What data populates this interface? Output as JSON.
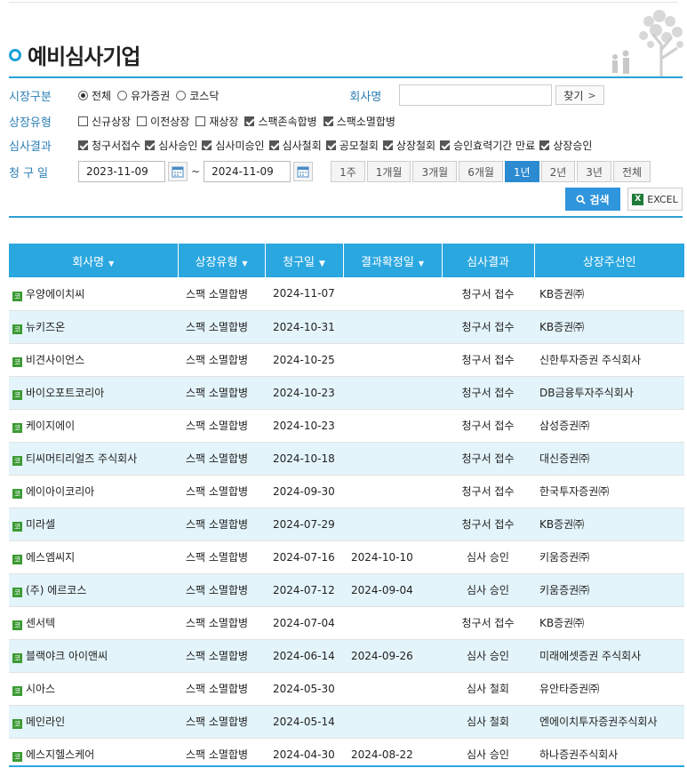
{
  "title": "예비심사기업",
  "filters": {
    "market": {
      "label": "시장구분",
      "options": [
        {
          "text": "전체",
          "selected": true
        },
        {
          "text": "유가증권",
          "selected": false
        },
        {
          "text": "코스닥",
          "selected": false
        }
      ],
      "company_label": "회사명",
      "company_value": "",
      "find_label": "찾기"
    },
    "listing_type": {
      "label": "상장유형",
      "options": [
        {
          "text": "신규상장",
          "checked": false
        },
        {
          "text": "이전상장",
          "checked": false
        },
        {
          "text": "재상장",
          "checked": false
        },
        {
          "text": "스팩존속합병",
          "checked": true
        },
        {
          "text": "스팩소멸합병",
          "checked": true
        }
      ]
    },
    "review_result": {
      "label": "심사결과",
      "options": [
        {
          "text": "청구서접수",
          "checked": true
        },
        {
          "text": "심사승인",
          "checked": true
        },
        {
          "text": "심사미승인",
          "checked": true
        },
        {
          "text": "심사철회",
          "checked": true
        },
        {
          "text": "공모철회",
          "checked": true
        },
        {
          "text": "상장철회",
          "checked": true
        },
        {
          "text": "승인효력기간 만료",
          "checked": true
        },
        {
          "text": "상장승인",
          "checked": true
        }
      ]
    },
    "claim_date": {
      "label": "청 구 일",
      "from": "2023-11-09",
      "to": "2024-11-09",
      "tilde": "~",
      "periods": [
        {
          "text": "1주",
          "active": false
        },
        {
          "text": "1개월",
          "active": false
        },
        {
          "text": "3개월",
          "active": false
        },
        {
          "text": "6개월",
          "active": false
        },
        {
          "text": "1년",
          "active": true
        },
        {
          "text": "2년",
          "active": false
        },
        {
          "text": "3년",
          "active": false
        },
        {
          "text": "전체",
          "active": false
        }
      ]
    }
  },
  "buttons": {
    "search": "검색",
    "excel": "EXCEL"
  },
  "table": {
    "headers": [
      {
        "text": "회사명",
        "sort": true
      },
      {
        "text": "상장유형",
        "sort": true
      },
      {
        "text": "청구일",
        "sort": true,
        "bold_arrow": true
      },
      {
        "text": "결과확정일",
        "sort": true
      },
      {
        "text": "심사결과",
        "sort": false
      },
      {
        "text": "상장주선인",
        "sort": false
      }
    ],
    "market_mark": "코",
    "rows": [
      [
        "우양에이치씨",
        "스팩 소멸합병",
        "2024-11-07",
        "",
        "청구서 접수",
        "KB증권㈜"
      ],
      [
        "뉴키즈온",
        "스팩 소멸합병",
        "2024-10-31",
        "",
        "청구서 접수",
        "KB증권㈜"
      ],
      [
        "비견사이언스",
        "스팩 소멸합병",
        "2024-10-25",
        "",
        "청구서 접수",
        "신한투자증권 주식회사"
      ],
      [
        "바이오포트코리아",
        "스팩 소멸합병",
        "2024-10-23",
        "",
        "청구서 접수",
        "DB금융투자주식회사"
      ],
      [
        "케이지에이",
        "스팩 소멸합병",
        "2024-10-23",
        "",
        "청구서 접수",
        "삼성증권㈜"
      ],
      [
        "티씨머티리얼즈 주식회사",
        "스팩 소멸합병",
        "2024-10-18",
        "",
        "청구서 접수",
        "대신증권㈜"
      ],
      [
        "에이아이코리아",
        "스팩 소멸합병",
        "2024-09-30",
        "",
        "청구서 접수",
        "한국투자증권㈜"
      ],
      [
        "미라셀",
        "스팩 소멸합병",
        "2024-07-29",
        "",
        "청구서 접수",
        "KB증권㈜"
      ],
      [
        "에스엠씨지",
        "스팩 소멸합병",
        "2024-07-16",
        "2024-10-10",
        "심사 승인",
        "키움증권㈜"
      ],
      [
        "(주) 에르코스",
        "스팩 소멸합병",
        "2024-07-12",
        "2024-09-04",
        "심사 승인",
        "키움증권㈜"
      ],
      [
        "센서텍",
        "스팩 소멸합병",
        "2024-07-04",
        "",
        "청구서 접수",
        "KB증권㈜"
      ],
      [
        "블랙야크 아이앤씨",
        "스팩 소멸합병",
        "2024-06-14",
        "2024-09-26",
        "심사 승인",
        "미래에셋증권 주식회사"
      ],
      [
        "시아스",
        "스팩 소멸합병",
        "2024-05-30",
        "",
        "심사 철회",
        "유안타증권㈜"
      ],
      [
        "메인라인",
        "스팩 소멸합병",
        "2024-05-14",
        "",
        "심사 철회",
        "엔에이치투자증권주식회사"
      ],
      [
        "에스지헬스케어",
        "스팩 소멸합병",
        "2024-04-30",
        "2024-08-22",
        "심사 승인",
        "하나증권주식회사"
      ]
    ]
  }
}
